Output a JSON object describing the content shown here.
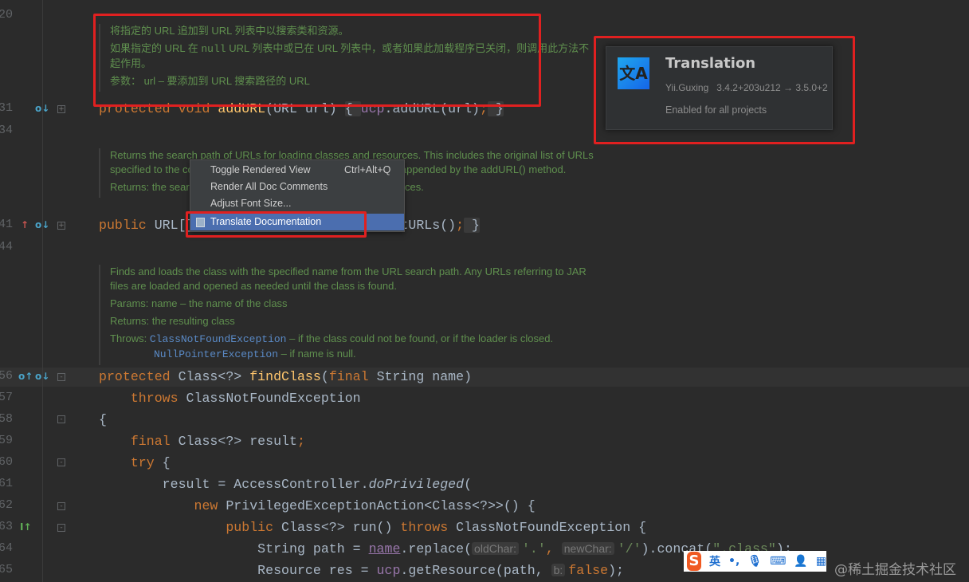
{
  "gutter": {
    "line_numbers": [
      "20",
      "31",
      "34",
      "41",
      "44",
      "56",
      "57",
      "58",
      "59",
      "60",
      "61",
      "62",
      "63",
      "64",
      "65"
    ]
  },
  "doc_blocks": {
    "add_url": {
      "p1": "将指定的 URL 追加到 URL 列表中以搜索类和资源。",
      "p2_a": "如果指定的 URL 在 ",
      "p2_code": "null",
      "p2_b": " URL 列表中或已在 URL 列表中，或者如果此加载程序已关闭，则调用此方法不起作用。",
      "param_label": "参数：",
      "param_text": "url – 要添加到 URL 搜索路径的 URL"
    },
    "get_urls": {
      "p1": "Returns the search path of URLs for loading classes and resources. This includes the original list of URLs specified to the constructor, along with any URLs subsequently appended by the addURL() method.",
      "returns": "Returns: the search path of URLs for loading classes and resources."
    },
    "find_class": {
      "p1": "Finds and loads the class with the specified name from the URL search path. Any URLs referring to JAR files are loaded and opened as needed until the class is found.",
      "params": "Params:  name – the name of the class",
      "returns": "Returns: the resulting class",
      "throws_label": "Throws:",
      "throws1_link": "ClassNotFoundException",
      "throws1_text": " – if the class could not be found, or if the loader is closed.",
      "throws2_link": "NullPointerException",
      "throws2_text": " – if name is null."
    }
  },
  "code_lines": [
    {
      "num": "31",
      "tokens": [
        [
          "protected void ",
          "kw"
        ],
        [
          "addURL",
          "fn"
        ],
        [
          "(URL url) ",
          ""
        ],
        [
          "{ ",
          "fb"
        ],
        [
          "ucp",
          "fld"
        ],
        [
          ".addURL(url)",
          ""
        ],
        [
          ";",
          "kw"
        ],
        [
          " }",
          "fb"
        ]
      ]
    },
    {
      "num": "41",
      "tokens": [
        [
          "public ",
          "kw"
        ],
        [
          "URL[] getURLs() { return ucp.getURLs()",
          ""
        ],
        [
          ";",
          "kw"
        ],
        [
          " }",
          "fb"
        ]
      ]
    },
    {
      "num": "56",
      "tokens": [
        [
          "protected ",
          "kw"
        ],
        [
          "Class<?> ",
          ""
        ],
        [
          "findClass",
          "fn"
        ],
        [
          "(",
          ""
        ],
        [
          "final ",
          "kw"
        ],
        [
          "String name)",
          ""
        ]
      ]
    },
    {
      "num": "57",
      "tokens": [
        [
          "    throws ",
          "kw"
        ],
        [
          "ClassNotFoundException",
          ""
        ]
      ]
    },
    {
      "num": "58",
      "tokens": [
        [
          "{",
          ""
        ]
      ]
    },
    {
      "num": "59",
      "tokens": [
        [
          "    final ",
          "kw"
        ],
        [
          "Class<?> result",
          ""
        ],
        [
          ";",
          "kw"
        ]
      ]
    },
    {
      "num": "60",
      "tokens": [
        [
          "    try ",
          "kw"
        ],
        [
          "{",
          ""
        ]
      ]
    },
    {
      "num": "61",
      "tokens": [
        [
          "        result = AccessController.",
          ""
        ],
        [
          "doPrivileged",
          "it"
        ],
        [
          "(",
          ""
        ]
      ]
    },
    {
      "num": "62",
      "tokens": [
        [
          "            new ",
          "kw"
        ],
        [
          "PrivilegedExceptionAction<Class<?>>() {",
          ""
        ]
      ]
    },
    {
      "num": "63",
      "tokens": [
        [
          "                public ",
          "kw"
        ],
        [
          "Class<?> run() ",
          ""
        ],
        [
          "throws ",
          "kw"
        ],
        [
          "ClassNotFoundException {",
          ""
        ]
      ]
    },
    {
      "num": "64",
      "tokens": [
        [
          "                    String path = ",
          ""
        ],
        [
          "name",
          "fld ul"
        ],
        [
          ".replace(",
          ""
        ],
        [
          "oldChar:",
          "hint"
        ],
        [
          "'.'",
          "str"
        ],
        [
          ", ",
          "kw"
        ],
        [
          "newChar:",
          "hint"
        ],
        [
          "'/'",
          "str"
        ],
        [
          ").concat(",
          ""
        ],
        [
          "\".class\"",
          "str"
        ],
        [
          ");",
          ""
        ]
      ]
    },
    {
      "num": "65",
      "tokens": [
        [
          "                    Resource res = ",
          ""
        ],
        [
          "ucp",
          "fld"
        ],
        [
          ".getResource(path, ",
          ""
        ],
        [
          "b:",
          "hint"
        ],
        [
          "false",
          "kw"
        ],
        [
          ");",
          ""
        ]
      ]
    }
  ],
  "context_menu": {
    "items": [
      {
        "label": "Toggle Rendered View",
        "shortcut": "Ctrl+Alt+Q"
      },
      {
        "label": "Render All Doc Comments",
        "shortcut": ""
      },
      {
        "label": "Adjust Font Size...",
        "shortcut": ""
      },
      {
        "label": "Translate Documentation",
        "shortcut": "",
        "selected": true,
        "icon": "translate-doc-icon"
      }
    ]
  },
  "plugin_card": {
    "name": "Translation",
    "vendor": "Yii.Guxing",
    "version": "3.4.2+203u212 → 3.5.0+2",
    "status": "Enabled for all projects",
    "icon": "translation-logo",
    "icon_text": "文A"
  },
  "ime_toolbar": {
    "lang": "英",
    "punct": "•,",
    "icons": [
      "sogou-logo",
      "microphone-icon",
      "keyboard-icon",
      "user-skin-icon",
      "apps-grid-icon"
    ]
  },
  "watermark": "@稀土掘金技术社区",
  "colors": {
    "keyword": "#cc7832",
    "method": "#ffc66d",
    "doc": "#5f8f4e",
    "annotation_box": "#e02020",
    "menu_selected": "#4b6eaf"
  }
}
